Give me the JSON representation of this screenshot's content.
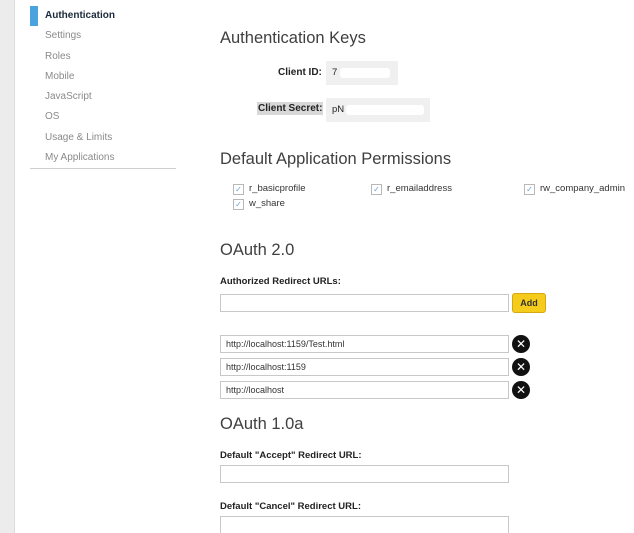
{
  "sidebar": {
    "items": [
      {
        "label": "Authentication"
      },
      {
        "label": "Settings"
      },
      {
        "label": "Roles"
      },
      {
        "label": "Mobile"
      },
      {
        "label": "JavaScript"
      },
      {
        "label": "OS"
      },
      {
        "label": "Usage & Limits"
      },
      {
        "label": "My Applications"
      }
    ],
    "active_index": 0
  },
  "auth_keys": {
    "title": "Authentication Keys",
    "client_id_label": "Client ID:",
    "client_id_value": "7",
    "client_secret_label": "Client Secret:",
    "client_secret_value": "pN"
  },
  "permissions": {
    "title": "Default Application Permissions",
    "items": [
      {
        "label": "r_basicprofile",
        "checked": true
      },
      {
        "label": "r_emailaddress",
        "checked": true
      },
      {
        "label": "rw_company_admin",
        "checked": true
      },
      {
        "label": "w_share",
        "checked": true
      }
    ]
  },
  "oauth2": {
    "title": "OAuth 2.0",
    "redirect_label": "Authorized Redirect URLs:",
    "new_url_value": "",
    "add_label": "Add",
    "urls": [
      "http://localhost:1159/Test.html",
      "http://localhost:1159",
      "http://localhost"
    ]
  },
  "oauth1": {
    "title": "OAuth 1.0a",
    "accept_label": "Default \"Accept\" Redirect URL:",
    "accept_value": "",
    "cancel_label": "Default \"Cancel\" Redirect URL:",
    "cancel_value": ""
  },
  "icons": {
    "checkbox": "checkmark-icon",
    "remove": "close-circle-icon"
  },
  "colors": {
    "accent": "#4aa3df",
    "add_button": "#f5cb1c"
  }
}
